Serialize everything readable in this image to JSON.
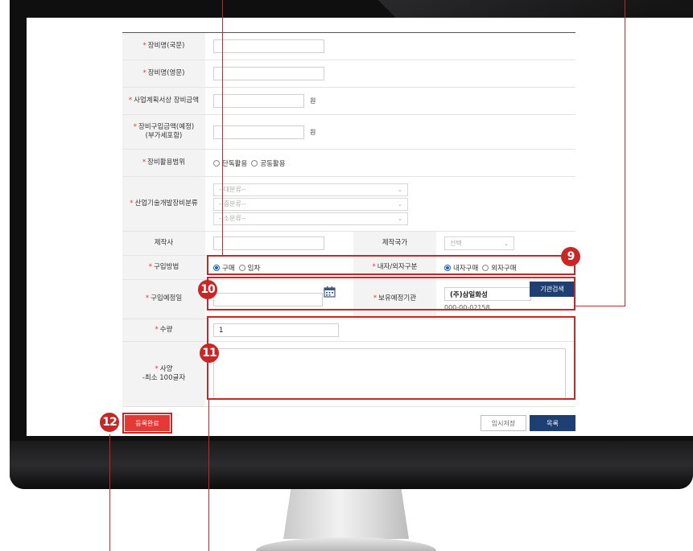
{
  "form": {
    "rows": {
      "name_kr": {
        "label": "장비명(국문)",
        "value": ""
      },
      "name_en": {
        "label": "장비명(영문)",
        "value": ""
      },
      "plan_amount": {
        "label": "사업계획서상 장비금액",
        "value": "",
        "unit": "원"
      },
      "purchase_amount": {
        "label": "장비구입금액(예정)",
        "sublabel": "(부가세포함)",
        "value": "",
        "unit": "원"
      },
      "usage_scope": {
        "label": "장비활용범위",
        "options": [
          "단독활용",
          "공동활용"
        ]
      },
      "classification": {
        "label": "산업기술개발장비분류",
        "selects": [
          "--대분류--",
          "--중분류--",
          "--소분류--"
        ]
      },
      "maker": {
        "label": "제작사",
        "value": ""
      },
      "maker_country": {
        "label": "제작국가",
        "placeholder": "선택"
      },
      "acquire_method": {
        "label": "구입방법",
        "options": [
          "구매",
          "임차"
        ],
        "selected": "구매"
      },
      "origin_type": {
        "label": "내자/외자구분",
        "options": [
          "내자구매",
          "외자구매"
        ],
        "selected": "내자구매"
      },
      "purchase_date": {
        "label": "구입예정일",
        "value": ""
      },
      "holding_org": {
        "label": "보유예정기관",
        "name": "(주)삼일화성",
        "code": "000-00-02158",
        "search_button": "기관검색"
      },
      "quantity": {
        "label": "수량",
        "value": "1"
      },
      "spec": {
        "label": "사양",
        "sublabel": "-최소 100글자",
        "value": ""
      }
    },
    "required_mark": "*",
    "buttons": {
      "complete": "등록완료",
      "temp_save": "임시저장",
      "list": "목록"
    }
  },
  "callouts": [
    "9",
    "10",
    "11",
    "12"
  ],
  "colors": {
    "accent_red": "#c62828",
    "button_navy": "#1e3f73",
    "radio_blue": "#1565c0"
  }
}
